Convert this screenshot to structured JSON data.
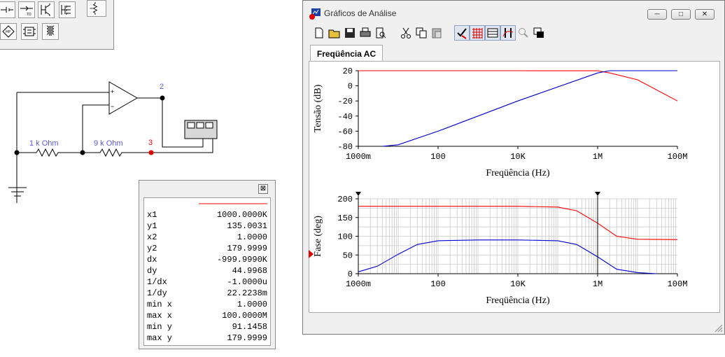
{
  "parts_bin": {
    "top_row": [
      "voltage-source-icon",
      "ammeter-icon",
      "transistor-icon",
      "mosfet-icon",
      "potentiometer-icon"
    ],
    "bottom_row": [
      "hp-analyzer-icon",
      "ic-icon",
      "transformer-icon"
    ]
  },
  "schematic": {
    "r1_label": "1 k Ohm",
    "r2_label": "9 k Ohm",
    "node2_label": "2",
    "node3_label": "3",
    "wire_color": "#000000",
    "label_color": "#5a5ad0",
    "probe_color": "#e00000"
  },
  "window": {
    "title": "Gráficos de Análise",
    "minimize": "─",
    "maximize": "□",
    "close": "✕"
  },
  "toolbar": {
    "buttons": [
      "new-icon",
      "open-icon",
      "save-icon",
      "print-icon",
      "print-preview-icon",
      "cut-icon",
      "copy-icon",
      "paste-icon",
      "properties-icon",
      "grid-icon",
      "table-icon",
      "cursor-icon",
      "zoom-icon",
      "window-icon"
    ],
    "active": [
      "properties-icon",
      "grid-icon",
      "table-icon",
      "cursor-icon"
    ]
  },
  "tab": {
    "label": "Freqüência AC"
  },
  "chart_data": [
    {
      "type": "line",
      "ylabel": "Tensão (dB)",
      "xlabel": "Freqüência (Hz)",
      "xscale": "log",
      "xlim": [
        1,
        100000000
      ],
      "ylim": [
        -80,
        20
      ],
      "x_ticks": [
        "1000m",
        "100",
        "10K",
        "1M",
        "100M"
      ],
      "y_ticks": [
        "20",
        "0",
        "-20",
        "-40",
        "-60",
        "-80"
      ],
      "grid": false,
      "series": [
        {
          "color": "#ff0000",
          "x": [
            1,
            100,
            10000,
            1000000,
            2000000,
            10000000,
            100000000
          ],
          "values": [
            20,
            20,
            20,
            19.9,
            17,
            8,
            -20
          ]
        },
        {
          "color": "#0000cc",
          "x": [
            4,
            10,
            100,
            10000,
            1000000,
            2000000,
            100000000
          ],
          "values": [
            -80,
            -78,
            -60,
            -20,
            17,
            20,
            20
          ]
        }
      ]
    },
    {
      "type": "line",
      "ylabel": "Fase (deg)",
      "xlabel": "Freqüência (Hz)",
      "xscale": "log",
      "xlim": [
        1,
        100000000
      ],
      "ylim": [
        0,
        200
      ],
      "x_ticks": [
        "1000m",
        "100",
        "10K",
        "1M",
        "100M"
      ],
      "y_ticks": [
        "200",
        "150",
        "100",
        "50",
        "0"
      ],
      "grid": true,
      "series": [
        {
          "color": "#ff0000",
          "x": [
            1,
            100,
            10000,
            100000,
            300000,
            1000000,
            3000000,
            10000000,
            100000000
          ],
          "values": [
            180,
            180,
            180,
            178,
            168,
            135,
            100,
            92,
            91
          ]
        },
        {
          "color": "#0000cc",
          "x": [
            1,
            3,
            10,
            30,
            100,
            1000,
            10000,
            100000,
            300000,
            1000000,
            3000000,
            10000000,
            30000000
          ],
          "values": [
            5,
            20,
            52,
            78,
            88,
            90,
            90,
            88,
            78,
            45,
            12,
            3,
            0
          ]
        }
      ]
    }
  ],
  "readout": {
    "close": "⊠",
    "trace_color": "#ff0000",
    "rows": [
      {
        "k": "x1",
        "v": "1000.0000K"
      },
      {
        "k": "y1",
        "v": "135.0031"
      },
      {
        "k": "x2",
        "v": "1.0000"
      },
      {
        "k": "y2",
        "v": "179.9999"
      },
      {
        "k": "dx",
        "v": "-999.9990K"
      },
      {
        "k": "dy",
        "v": "44.9968"
      },
      {
        "k": "1/dx",
        "v": "-1.0000u"
      },
      {
        "k": "1/dy",
        "v": "22.2238m"
      },
      {
        "k": "min x",
        "v": "1.0000"
      },
      {
        "k": "max x",
        "v": "100.0000M"
      },
      {
        "k": "min y",
        "v": "91.1458"
      },
      {
        "k": "max y",
        "v": "179.9999"
      }
    ]
  }
}
